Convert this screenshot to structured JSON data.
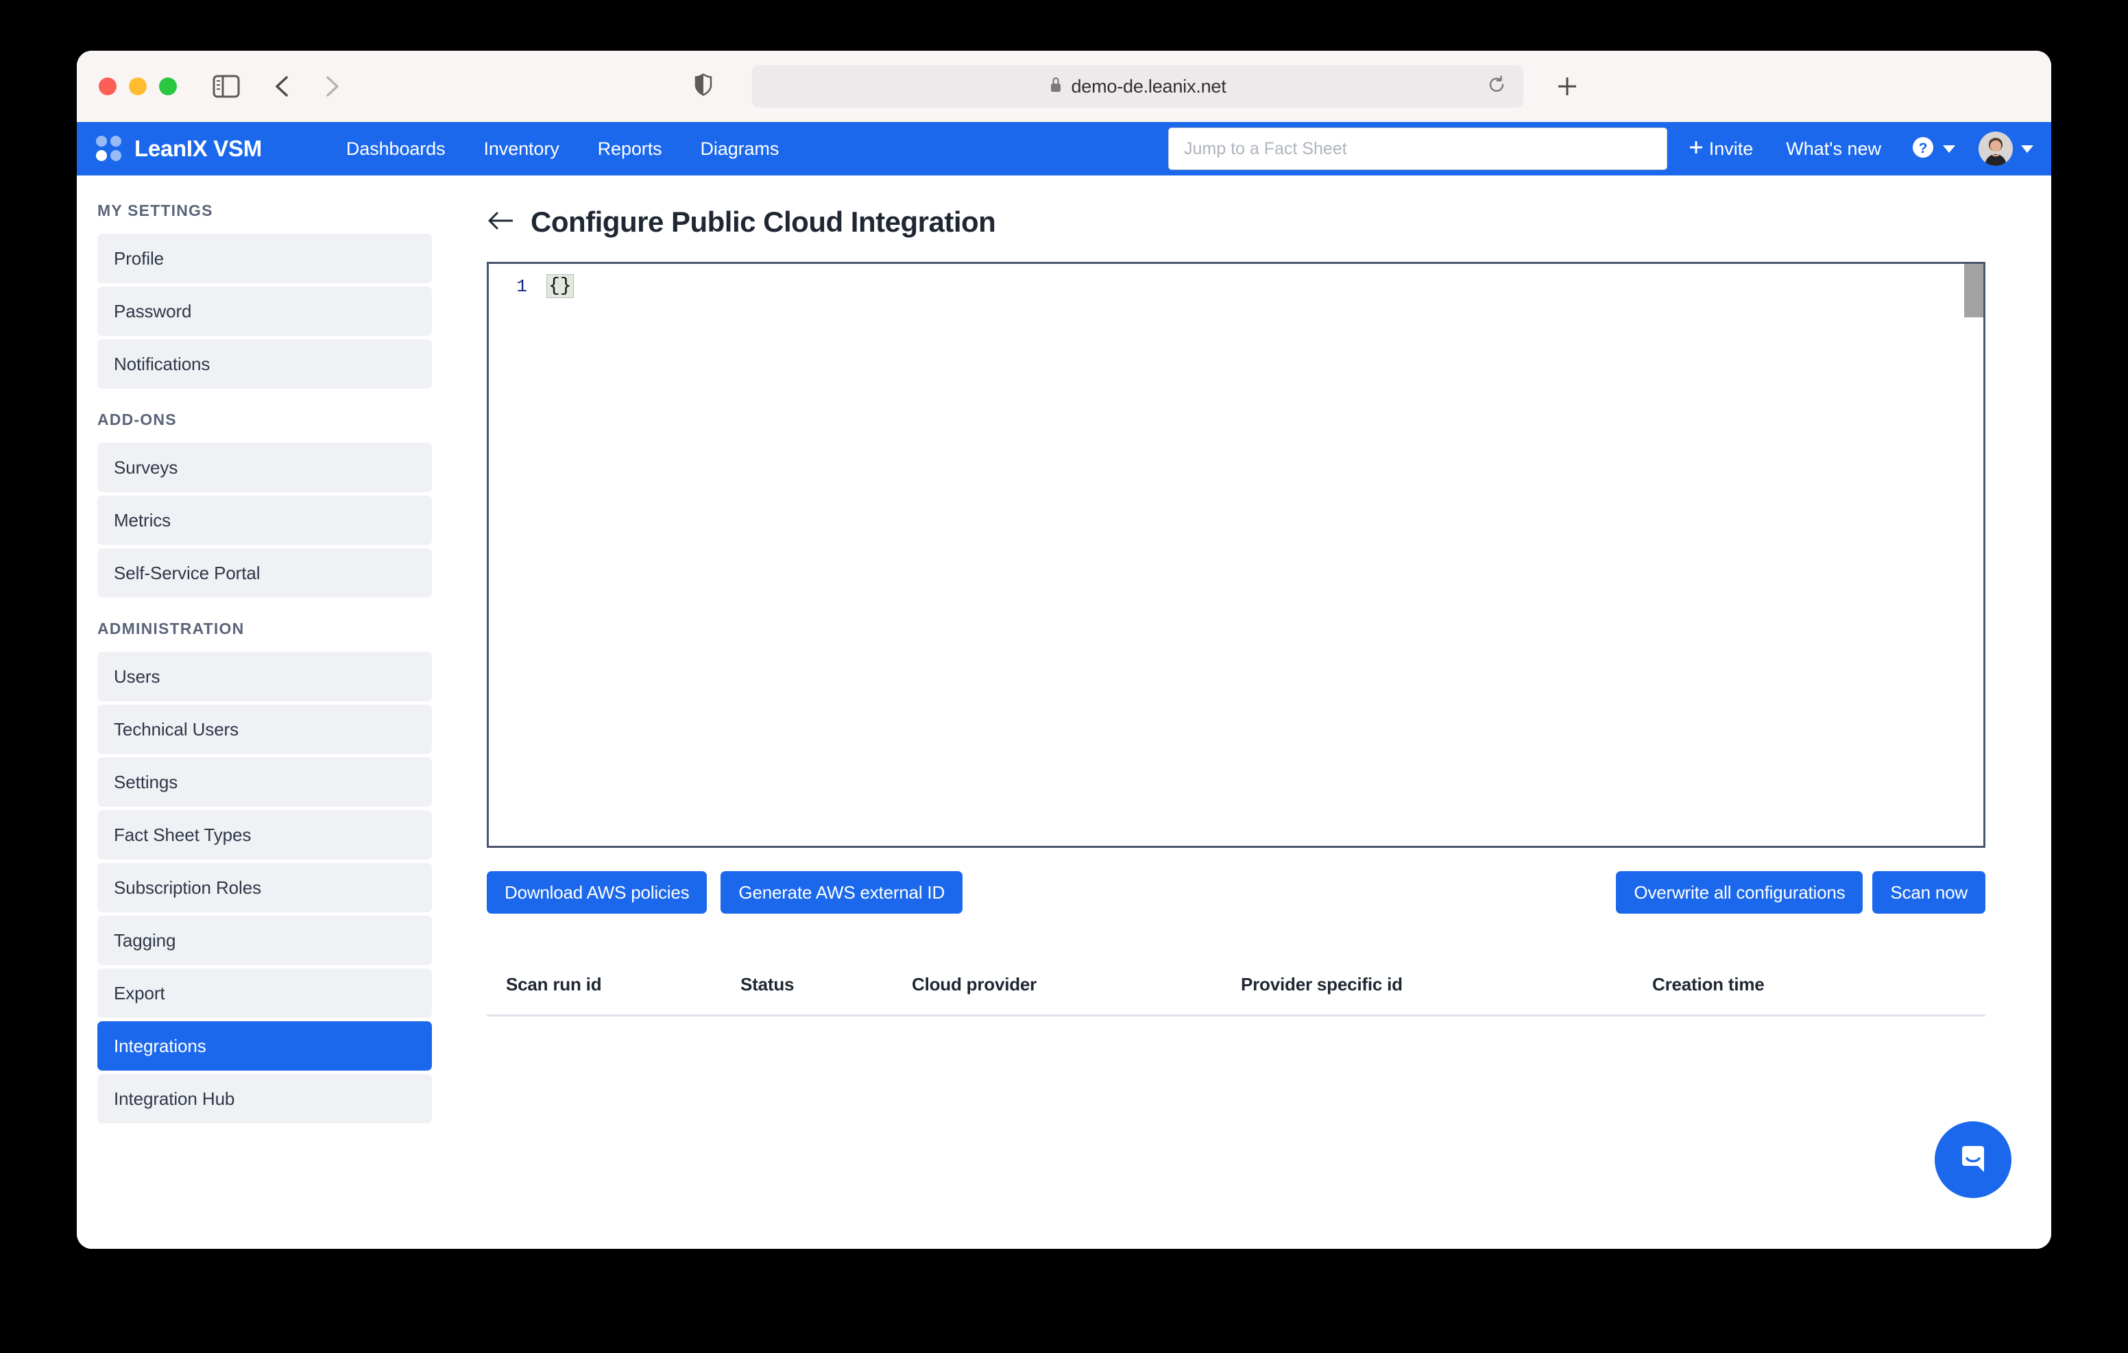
{
  "browser": {
    "url": "demo-de.leanix.net",
    "lock_icon": "lock-icon",
    "shield_icon": "shield-icon",
    "reload_icon": "reload-icon",
    "new_tab_icon": "plus-icon",
    "sidebar_toggle_icon": "sidebar-toggle-icon",
    "back_icon": "chevron-left-icon",
    "forward_icon": "chevron-right-icon"
  },
  "topnav": {
    "brand": "LeanIX VSM",
    "logo_icon": "leanix-dots-logo-icon",
    "items": [
      {
        "label": "Dashboards"
      },
      {
        "label": "Inventory"
      },
      {
        "label": "Reports"
      },
      {
        "label": "Diagrams"
      }
    ],
    "search": {
      "placeholder": "Jump to a Fact Sheet",
      "value": ""
    },
    "invite_label": "Invite",
    "invite_icon": "plus-icon",
    "whats_new_label": "What's new",
    "help_icon": "question-circle-icon",
    "avatar_icon": "user-avatar",
    "accent_color": "#1b68ec"
  },
  "sidebar": {
    "sections": [
      {
        "title": "MY SETTINGS",
        "items": [
          {
            "label": "Profile",
            "active": false
          },
          {
            "label": "Password",
            "active": false
          },
          {
            "label": "Notifications",
            "active": false
          }
        ]
      },
      {
        "title": "ADD-ONS",
        "items": [
          {
            "label": "Surveys",
            "active": false
          },
          {
            "label": "Metrics",
            "active": false
          },
          {
            "label": "Self-Service Portal",
            "active": false
          }
        ]
      },
      {
        "title": "ADMINISTRATION",
        "items": [
          {
            "label": "Users",
            "active": false
          },
          {
            "label": "Technical Users",
            "active": false
          },
          {
            "label": "Settings",
            "active": false
          },
          {
            "label": "Fact Sheet Types",
            "active": false
          },
          {
            "label": "Subscription Roles",
            "active": false
          },
          {
            "label": "Tagging",
            "active": false
          },
          {
            "label": "Export",
            "active": false
          },
          {
            "label": "Integrations",
            "active": true
          },
          {
            "label": "Integration Hub",
            "active": false
          }
        ]
      }
    ]
  },
  "page": {
    "title": "Configure Public Cloud Integration",
    "back_icon": "arrow-left-icon"
  },
  "editor": {
    "line_numbers": [
      "1"
    ],
    "lines": [
      "{}"
    ],
    "bracket_highlight": "{}"
  },
  "actions": {
    "left": [
      {
        "label": "Download AWS policies",
        "name": "download-aws-policies-button"
      },
      {
        "label": "Generate AWS external ID",
        "name": "generate-aws-external-id-button"
      }
    ],
    "right": [
      {
        "label": "Overwrite all configurations",
        "name": "overwrite-all-configurations-button"
      },
      {
        "label": "Scan now",
        "name": "scan-now-button"
      }
    ]
  },
  "scan_runs_table": {
    "columns": [
      "Scan run id",
      "Status",
      "Cloud provider",
      "Provider specific id",
      "Creation time"
    ],
    "rows": []
  },
  "intercom": {
    "icon": "chat-bubble-icon",
    "color": "#1b68ec"
  }
}
